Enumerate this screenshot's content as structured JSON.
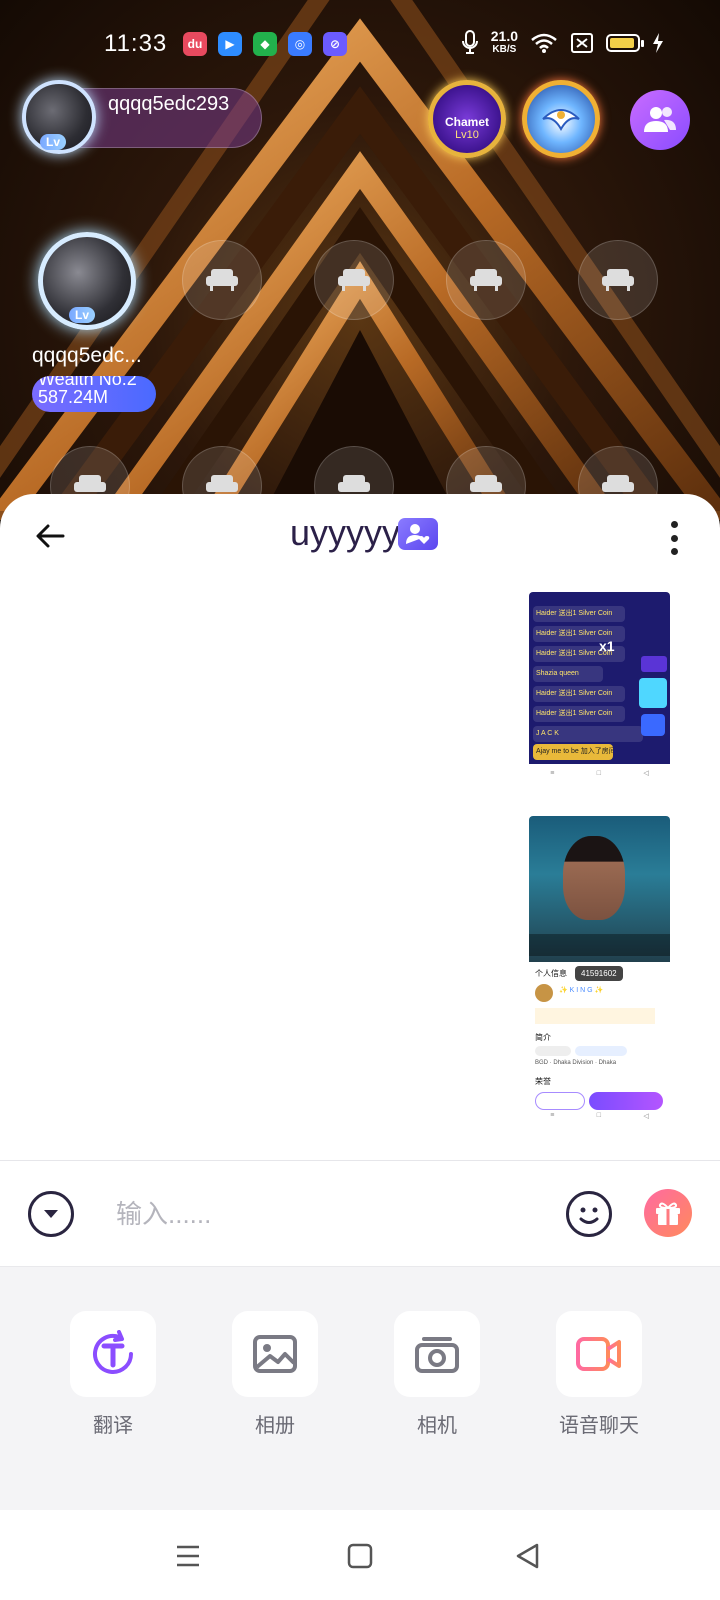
{
  "status_bar": {
    "time": "11:33",
    "net_speed_value": "21.0",
    "net_speed_unit": "KB/S",
    "battery_level": 0.8,
    "icons": [
      "baidu-app-icon",
      "video-app-icon",
      "shop-app-icon",
      "browser-app-icon",
      "clean-app-icon",
      "mic-icon",
      "wifi-icon",
      "sim-off-icon",
      "battery-icon",
      "charging-icon"
    ]
  },
  "room": {
    "host": {
      "name": "qqqq5edc293"
    },
    "badges": {
      "chamet_title": "Chamet",
      "chamet_level": "Lv10"
    },
    "occupant": {
      "name": "qqqq5edc...",
      "wealth_label": "Wealth No.2",
      "wealth_value": "587.24M"
    },
    "empty_seat_icon": "sofa-icon"
  },
  "chat": {
    "title": "uyyyyy",
    "screenshot_1": {
      "rows": [
        "Haider 送出1 Silver Coin",
        "Haider 送出1 Silver Coin",
        "Haider 送出1 Silver Coin",
        "Shazia queen",
        "Haider 送出1 Silver Coin",
        "Haider 送出1 Silver Coin",
        "J A C K",
        "Ajay me to be 加入了房间"
      ],
      "multiplier": "x1"
    },
    "screenshot_2": {
      "section_info": "个人信息",
      "user_id": "41591602",
      "user_name": "✨ K I N G ✨",
      "section_intro": "简介",
      "location": "BGD · Dhaka Division · Dhaka",
      "section_honor": "荣誉"
    }
  },
  "input_bar": {
    "placeholder": "输入......"
  },
  "tools": [
    {
      "label": "翻译",
      "icon": "translate-icon"
    },
    {
      "label": "相册",
      "icon": "album-icon"
    },
    {
      "label": "相机",
      "icon": "camera-icon"
    },
    {
      "label": "语音聊天",
      "icon": "video-call-icon"
    }
  ],
  "colors": {
    "accent_purple": "#8a4cff",
    "title_color": "#2b2048",
    "gift_gradient": "#ff6aa1"
  }
}
